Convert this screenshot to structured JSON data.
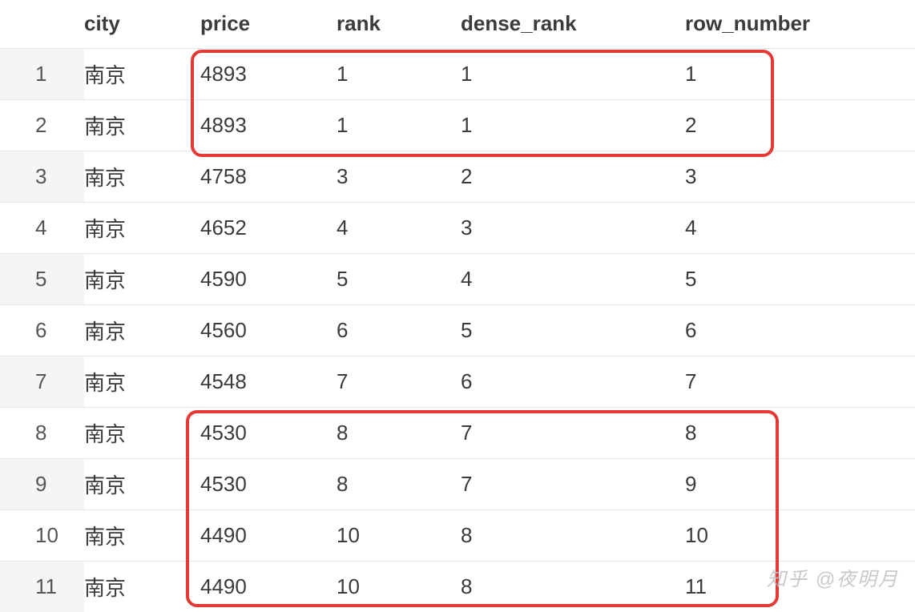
{
  "columns": {
    "c0": "",
    "c1": "city",
    "c2": "price",
    "c3": "rank",
    "c4": "dense_rank",
    "c5": "row_number"
  },
  "rows": [
    {
      "idx": "1",
      "city": "南京",
      "price": "4893",
      "rank": "1",
      "dense_rank": "1",
      "row_number": "1"
    },
    {
      "idx": "2",
      "city": "南京",
      "price": "4893",
      "rank": "1",
      "dense_rank": "1",
      "row_number": "2"
    },
    {
      "idx": "3",
      "city": "南京",
      "price": "4758",
      "rank": "3",
      "dense_rank": "2",
      "row_number": "3"
    },
    {
      "idx": "4",
      "city": "南京",
      "price": "4652",
      "rank": "4",
      "dense_rank": "3",
      "row_number": "4"
    },
    {
      "idx": "5",
      "city": "南京",
      "price": "4590",
      "rank": "5",
      "dense_rank": "4",
      "row_number": "5"
    },
    {
      "idx": "6",
      "city": "南京",
      "price": "4560",
      "rank": "6",
      "dense_rank": "5",
      "row_number": "6"
    },
    {
      "idx": "7",
      "city": "南京",
      "price": "4548",
      "rank": "7",
      "dense_rank": "6",
      "row_number": "7"
    },
    {
      "idx": "8",
      "city": "南京",
      "price": "4530",
      "rank": "8",
      "dense_rank": "7",
      "row_number": "8"
    },
    {
      "idx": "9",
      "city": "南京",
      "price": "4530",
      "rank": "8",
      "dense_rank": "7",
      "row_number": "9"
    },
    {
      "idx": "10",
      "city": "南京",
      "price": "4490",
      "rank": "10",
      "dense_rank": "8",
      "row_number": "10"
    },
    {
      "idx": "11",
      "city": "南京",
      "price": "4490",
      "rank": "10",
      "dense_rank": "8",
      "row_number": "11"
    }
  ],
  "watermark": "知乎 @夜明月"
}
